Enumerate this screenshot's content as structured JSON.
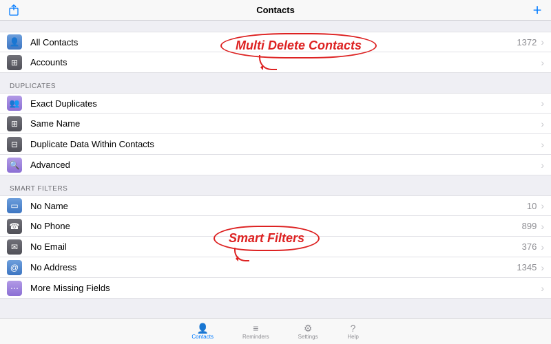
{
  "header": {
    "title": "Contacts"
  },
  "sections": {
    "top": [
      {
        "icon": "blue",
        "glyph": "👤",
        "label": "All Contacts",
        "count": "1372"
      },
      {
        "icon": "gray",
        "glyph": "⊞",
        "label": "Accounts",
        "count": ""
      }
    ],
    "duplicates_header": "DUPLICATES",
    "duplicates": [
      {
        "icon": "purple",
        "glyph": "👥",
        "label": "Exact Duplicates",
        "count": ""
      },
      {
        "icon": "gray",
        "glyph": "⊞",
        "label": "Same Name",
        "count": ""
      },
      {
        "icon": "gray",
        "glyph": "⊟",
        "label": "Duplicate Data Within Contacts",
        "count": ""
      },
      {
        "icon": "purple",
        "glyph": "🔍",
        "label": "Advanced",
        "count": ""
      }
    ],
    "smart_header": "SMART FILTERS",
    "smart": [
      {
        "icon": "blue",
        "glyph": "▭",
        "label": "No Name",
        "count": "10"
      },
      {
        "icon": "gray",
        "glyph": "☎",
        "label": "No Phone",
        "count": "899"
      },
      {
        "icon": "gray",
        "glyph": "✉",
        "label": "No Email",
        "count": "376"
      },
      {
        "icon": "blue",
        "glyph": "@",
        "label": "No Address",
        "count": "1345"
      },
      {
        "icon": "purple",
        "glyph": "⋯",
        "label": "More Missing Fields",
        "count": ""
      }
    ]
  },
  "callouts": {
    "c1": "Multi Delete Contacts",
    "c2": "Smart Filters"
  },
  "tabs": [
    {
      "label": "Contacts",
      "glyph": "👤",
      "active": true
    },
    {
      "label": "Reminders",
      "glyph": "≡",
      "active": false
    },
    {
      "label": "Settings",
      "glyph": "⚙",
      "active": false
    },
    {
      "label": "Help",
      "glyph": "?",
      "active": false
    }
  ]
}
